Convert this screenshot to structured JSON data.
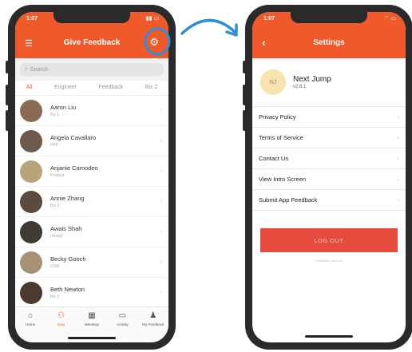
{
  "left_screen": {
    "status_time": "1:07",
    "title": "Give Feedback",
    "search_placeholder": "Search",
    "filters": [
      {
        "label": "All"
      },
      {
        "label": "Engineer"
      },
      {
        "label": "Feedback"
      },
      {
        "label": "Biz 2"
      }
    ],
    "people": [
      {
        "name": "Aaron Liu",
        "sub": "Biz 1"
      },
      {
        "name": "Angela Cavallaro",
        "sub": "HPP"
      },
      {
        "name": "Anjanie Camodeo",
        "sub": "Product"
      },
      {
        "name": "Annie Zhang",
        "sub": "Biz 3"
      },
      {
        "name": "Awais Shah",
        "sub": "Design"
      },
      {
        "name": "Becky Gooch",
        "sub": "DSM"
      },
      {
        "name": "Beth Newton",
        "sub": "Biz 3"
      }
    ],
    "tabs": [
      {
        "label": "Home",
        "icon": "home-icon"
      },
      {
        "label": "Give",
        "icon": "people-icon"
      },
      {
        "label": "Meetings",
        "icon": "calendar-icon"
      },
      {
        "label": "Activity",
        "icon": "chat-icon"
      },
      {
        "label": "My Feedback",
        "icon": "person-icon"
      }
    ]
  },
  "right_screen": {
    "status_time": "1:07",
    "title": "Settings",
    "profile": {
      "initials": "NJ",
      "name": "Next Jump",
      "version": "v2.8.1"
    },
    "items": [
      {
        "label": "Privacy Policy"
      },
      {
        "label": "Terms of Service"
      },
      {
        "label": "Contact Us"
      },
      {
        "label": "View Intro Screen"
      },
      {
        "label": "Submit App Feedback"
      }
    ],
    "logout_label": "LOG OUT",
    "fine_print": "Feedback Labs 101"
  },
  "colors": {
    "accent": "#f05a2b",
    "logout": "#e64a3d",
    "annotation": "#2f8fd6"
  }
}
